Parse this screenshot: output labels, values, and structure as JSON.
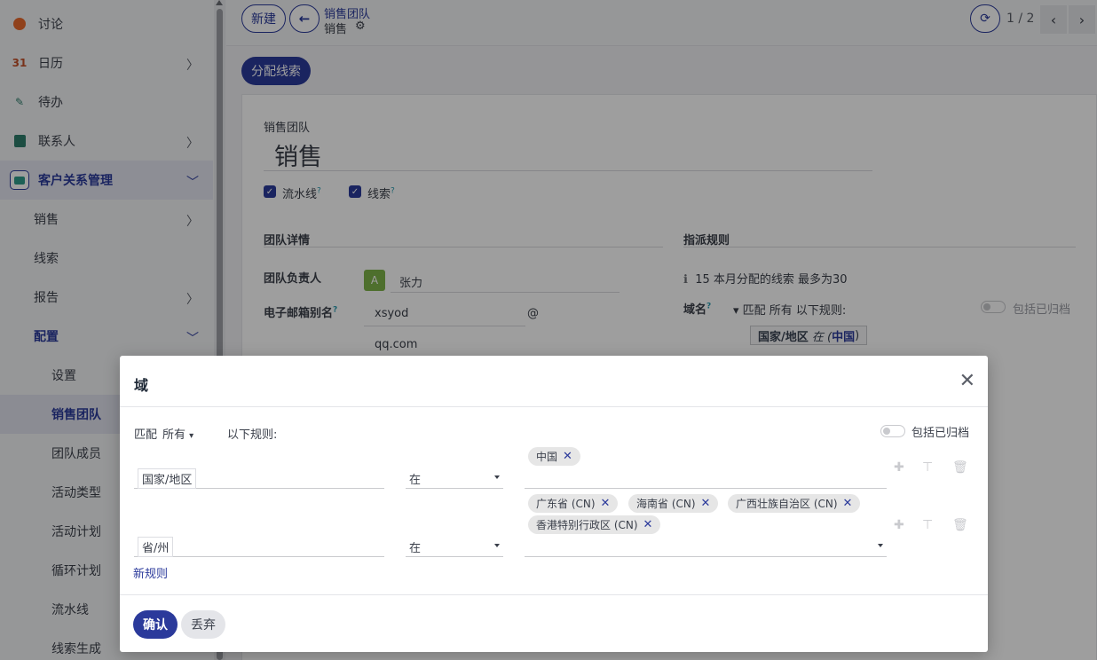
{
  "sidebar": {
    "items": [
      {
        "label": "讨论"
      },
      {
        "label": "日历"
      },
      {
        "label": "待办"
      },
      {
        "label": "联系人"
      },
      {
        "label": "客户关系管理"
      },
      {
        "label": "销售"
      },
      {
        "label": "线索"
      },
      {
        "label": "报告"
      },
      {
        "label": "配置"
      },
      {
        "label": "设置"
      },
      {
        "label": "销售团队"
      },
      {
        "label": "团队成员"
      },
      {
        "label": "活动类型"
      },
      {
        "label": "活动计划"
      },
      {
        "label": "循环计划"
      },
      {
        "label": "流水线"
      },
      {
        "label": "线索生成"
      }
    ],
    "calendar_num": "31"
  },
  "topbar": {
    "new_label": "新建",
    "breadcrumb_parent": "销售团队",
    "breadcrumb_current": "销售",
    "pager": "1 / 2"
  },
  "form": {
    "assign_label": "分配线索",
    "team_label": "销售团队",
    "team_name": "销售",
    "pipeline_label": "流水线",
    "leads_label": "线索",
    "details_head": "团队详情",
    "assign_rules_head": "指派规则",
    "leader_label": "团队负责人",
    "leader_avatar": "A",
    "leader_name": "张力",
    "email_alias_label": "电子邮箱别名",
    "email_alias_value": "xsyod",
    "email_at": "@",
    "email_domain": "qq.com",
    "assign_info": "15 本月分配的线索 最多为30",
    "domain_label": "域名",
    "domain_match": "匹配 所有 以下规则:",
    "include_archived": "包括已归档",
    "domain_tag_field": "国家/地区",
    "domain_tag_op": "在 (",
    "domain_tag_value": "中国",
    "domain_tag_close": ")"
  },
  "modal": {
    "title": "域",
    "match_prefix": "匹配",
    "match_mode": "所有",
    "match_suffix": "以下规则:",
    "include_archived": "包括已归档",
    "rules": [
      {
        "field": "国家/地区",
        "operator": "在",
        "values": [
          "中国"
        ]
      },
      {
        "field": "省/州",
        "operator": "在",
        "values": [
          "广东省 (CN)",
          "海南省 (CN)",
          "广西壮族自治区 (CN)",
          "香港特别行政区 (CN)"
        ]
      }
    ],
    "new_rule": "新规则",
    "confirm": "确认",
    "discard": "丢弃"
  },
  "colors": {
    "accent": "#2b3a9b"
  }
}
